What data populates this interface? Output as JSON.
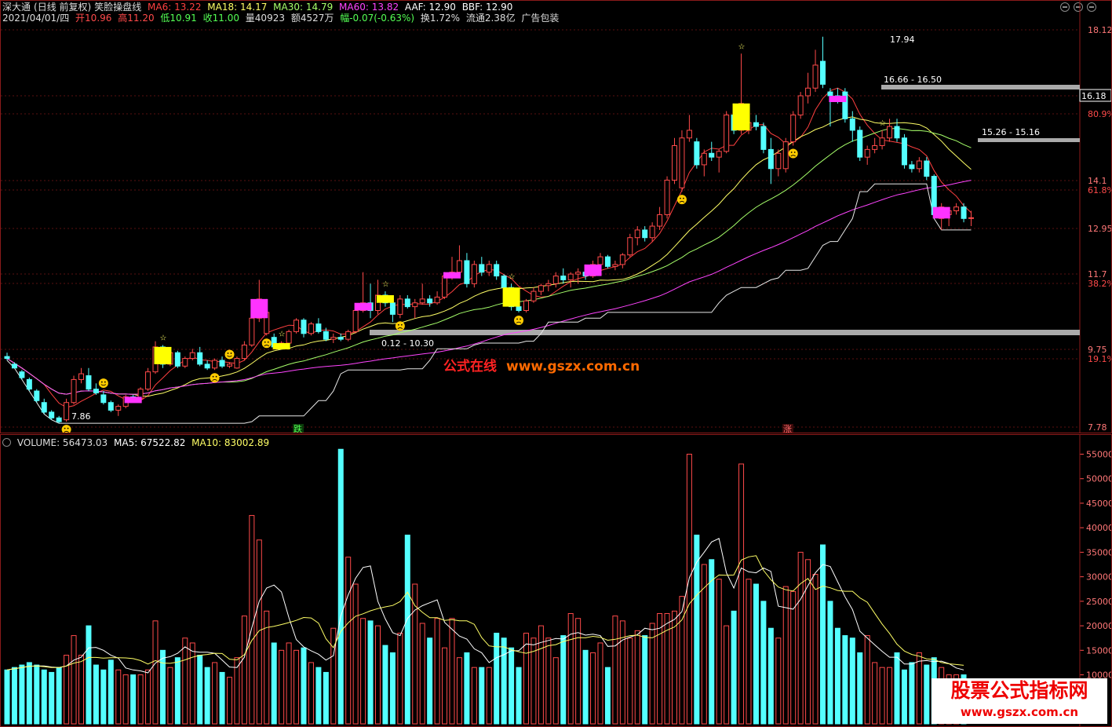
{
  "header1": {
    "security": "深大通",
    "mode": "(日线 前复权)",
    "indicator": "笑脸操盘线",
    "ma6": "MA6: 13.22",
    "ma18": "MA18: 14.17",
    "ma30": "MA30: 14.79",
    "ma60": "MA60: 13.82",
    "aaf": "AAF: 12.90",
    "bbf": "BBF: 12.90"
  },
  "header2": {
    "date": "2021/04/01/四",
    "open": "开10.96",
    "high": "高11.20",
    "low": "低10.91",
    "close": "收11.00",
    "volume": "量40923",
    "amount": "额4527万",
    "change": "幅-0.07(-0.63%)",
    "turnover": "换1.72%",
    "float": "流通2.38亿",
    "ads": "广告包装"
  },
  "price_axis": [
    "18.12",
    "16.18",
    "80.9%",
    "14.1",
    "61.8%",
    "12.95",
    "11.7",
    "38.2%",
    "9.75",
    "19.1%",
    "7.78"
  ],
  "price_tag": "16.18",
  "annotations": {
    "high_label": "17.94",
    "band1": "16.66 - 16.50",
    "band2": "15.26 - 15.16",
    "band3": "0.12 - 10.30",
    "low_label": "7.86",
    "fall_marker": "跌",
    "rise_marker": "涨"
  },
  "volume_header": {
    "volume": "VOLUME: 56473.03",
    "ma5": "MA5: 67522.82",
    "ma10": "MA10: 83002.89"
  },
  "volume_axis": [
    "55000",
    "50000",
    "45000",
    "40000",
    "35000",
    "30000",
    "25000",
    "20000",
    "15000",
    "10000"
  ],
  "watermarks": {
    "cn": "公式在线",
    "url": "www.gszx.com.cn",
    "brand": "股票公式指标网",
    "brand_url": "www.gszx.com.cn"
  },
  "colors": {
    "up": "#ff4a4a",
    "down": "#54ffff",
    "ma6": "#ff4040",
    "ma18": "#ffff66",
    "ma30": "#a6ff6a",
    "ma60": "#ff44ff",
    "band": "#aaaaaa"
  },
  "chart_data": {
    "type": "candlestick",
    "y_range": [
      7.78,
      18.12
    ],
    "candles": [
      {
        "o": 9.6,
        "h": 9.7,
        "l": 9.5,
        "c": 9.55
      },
      {
        "o": 9.4,
        "h": 9.45,
        "l": 9.3,
        "c": 9.3
      },
      {
        "o": 9.2,
        "h": 9.25,
        "l": 9.0,
        "c": 9.05
      },
      {
        "o": 9.0,
        "h": 9.05,
        "l": 8.7,
        "c": 8.75
      },
      {
        "o": 8.7,
        "h": 8.75,
        "l": 8.4,
        "c": 8.45
      },
      {
        "o": 8.4,
        "h": 8.5,
        "l": 8.1,
        "c": 8.15
      },
      {
        "o": 8.15,
        "h": 8.2,
        "l": 7.95,
        "c": 8.0
      },
      {
        "o": 8.0,
        "h": 8.05,
        "l": 7.86,
        "c": 7.9
      },
      {
        "o": 7.95,
        "h": 8.5,
        "l": 7.9,
        "c": 8.4
      },
      {
        "o": 8.4,
        "h": 9.1,
        "l": 8.35,
        "c": 9.0
      },
      {
        "o": 9.0,
        "h": 9.3,
        "l": 8.9,
        "c": 9.15
      },
      {
        "o": 9.1,
        "h": 9.3,
        "l": 8.7,
        "c": 8.75
      },
      {
        "o": 8.75,
        "h": 8.9,
        "l": 8.6,
        "c": 8.65
      },
      {
        "o": 8.6,
        "h": 8.7,
        "l": 8.35,
        "c": 8.4
      },
      {
        "o": 8.4,
        "h": 8.45,
        "l": 8.15,
        "c": 8.2
      },
      {
        "o": 8.2,
        "h": 8.35,
        "l": 8.05,
        "c": 8.3
      },
      {
        "o": 8.3,
        "h": 8.6,
        "l": 8.25,
        "c": 8.55
      },
      {
        "o": 8.55,
        "h": 8.6,
        "l": 8.45,
        "c": 8.5
      },
      {
        "o": 8.5,
        "h": 8.8,
        "l": 8.45,
        "c": 8.75
      },
      {
        "o": 8.75,
        "h": 9.3,
        "l": 8.7,
        "c": 9.2
      },
      {
        "o": 9.2,
        "h": 10.0,
        "l": 9.15,
        "c": 9.85
      },
      {
        "o": 9.85,
        "h": 9.9,
        "l": 9.3,
        "c": 9.4
      },
      {
        "o": 9.4,
        "h": 9.8,
        "l": 9.35,
        "c": 9.7
      },
      {
        "o": 9.7,
        "h": 9.75,
        "l": 9.3,
        "c": 9.35
      },
      {
        "o": 9.35,
        "h": 9.6,
        "l": 9.3,
        "c": 9.55
      },
      {
        "o": 9.55,
        "h": 9.8,
        "l": 9.5,
        "c": 9.7
      },
      {
        "o": 9.7,
        "h": 9.85,
        "l": 9.35,
        "c": 9.4
      },
      {
        "o": 9.4,
        "h": 9.5,
        "l": 9.25,
        "c": 9.3
      },
      {
        "o": 9.3,
        "h": 9.55,
        "l": 9.25,
        "c": 9.5
      },
      {
        "o": 9.5,
        "h": 9.6,
        "l": 9.3,
        "c": 9.35
      },
      {
        "o": 9.35,
        "h": 9.45,
        "l": 9.3,
        "c": 9.4
      },
      {
        "o": 9.3,
        "h": 9.6,
        "l": 9.28,
        "c": 9.55
      },
      {
        "o": 9.55,
        "h": 10.0,
        "l": 9.5,
        "c": 9.9
      },
      {
        "o": 9.9,
        "h": 10.8,
        "l": 9.85,
        "c": 10.6
      },
      {
        "o": 10.6,
        "h": 11.6,
        "l": 10.5,
        "c": 11.1
      },
      {
        "o": 10.2,
        "h": 11.1,
        "l": 10.15,
        "c": 10.75
      },
      {
        "o": 10.1,
        "h": 10.2,
        "l": 9.8,
        "c": 9.85
      },
      {
        "o": 9.85,
        "h": 10.0,
        "l": 9.8,
        "c": 9.95
      },
      {
        "o": 9.95,
        "h": 10.3,
        "l": 9.9,
        "c": 10.25
      },
      {
        "o": 10.25,
        "h": 10.6,
        "l": 10.2,
        "c": 10.55
      },
      {
        "o": 10.55,
        "h": 10.6,
        "l": 10.1,
        "c": 10.2
      },
      {
        "o": 10.2,
        "h": 10.5,
        "l": 10.15,
        "c": 10.45
      },
      {
        "o": 10.45,
        "h": 10.6,
        "l": 10.2,
        "c": 10.25
      },
      {
        "o": 10.25,
        "h": 10.35,
        "l": 10.0,
        "c": 10.05
      },
      {
        "o": 10.05,
        "h": 10.2,
        "l": 9.95,
        "c": 10.1
      },
      {
        "o": 10.1,
        "h": 10.2,
        "l": 10.0,
        "c": 10.05
      },
      {
        "o": 10.05,
        "h": 10.3,
        "l": 10.0,
        "c": 10.25
      },
      {
        "o": 10.25,
        "h": 10.9,
        "l": 10.2,
        "c": 10.8
      },
      {
        "o": 10.8,
        "h": 11.8,
        "l": 10.75,
        "c": 11.0
      },
      {
        "o": 11.0,
        "h": 11.5,
        "l": 10.6,
        "c": 10.8
      },
      {
        "o": 10.8,
        "h": 11.6,
        "l": 10.7,
        "c": 11.2
      },
      {
        "o": 11.2,
        "h": 11.3,
        "l": 10.9,
        "c": 11.0
      },
      {
        "o": 11.0,
        "h": 11.1,
        "l": 10.5,
        "c": 10.7
      },
      {
        "o": 10.7,
        "h": 11.2,
        "l": 10.6,
        "c": 11.1
      },
      {
        "o": 11.1,
        "h": 11.2,
        "l": 10.85,
        "c": 10.9
      },
      {
        "o": 10.9,
        "h": 11.1,
        "l": 10.6,
        "c": 11.0
      },
      {
        "o": 11.0,
        "h": 11.5,
        "l": 10.95,
        "c": 11.1
      },
      {
        "o": 11.1,
        "h": 11.2,
        "l": 10.9,
        "c": 11.0
      },
      {
        "o": 11.0,
        "h": 11.3,
        "l": 10.95,
        "c": 11.15
      },
      {
        "o": 11.15,
        "h": 11.8,
        "l": 11.1,
        "c": 11.7
      },
      {
        "o": 11.7,
        "h": 12.2,
        "l": 11.6,
        "c": 11.8
      },
      {
        "o": 11.8,
        "h": 12.5,
        "l": 11.7,
        "c": 12.1
      },
      {
        "o": 12.1,
        "h": 12.3,
        "l": 11.4,
        "c": 11.5
      },
      {
        "o": 11.5,
        "h": 12.1,
        "l": 11.4,
        "c": 12.0
      },
      {
        "o": 12.0,
        "h": 12.2,
        "l": 11.7,
        "c": 11.8
      },
      {
        "o": 11.8,
        "h": 12.1,
        "l": 11.7,
        "c": 12.0
      },
      {
        "o": 12.0,
        "h": 12.1,
        "l": 11.6,
        "c": 11.7
      },
      {
        "o": 11.7,
        "h": 11.75,
        "l": 11.35,
        "c": 11.4
      },
      {
        "o": 11.4,
        "h": 11.5,
        "l": 10.8,
        "c": 10.9
      },
      {
        "o": 10.9,
        "h": 11.0,
        "l": 10.75,
        "c": 10.8
      },
      {
        "o": 10.8,
        "h": 11.1,
        "l": 10.75,
        "c": 11.05
      },
      {
        "o": 11.05,
        "h": 11.4,
        "l": 11.0,
        "c": 11.3
      },
      {
        "o": 11.3,
        "h": 11.5,
        "l": 11.2,
        "c": 11.45
      },
      {
        "o": 11.45,
        "h": 11.6,
        "l": 11.3,
        "c": 11.5
      },
      {
        "o": 11.5,
        "h": 11.8,
        "l": 11.4,
        "c": 11.7
      },
      {
        "o": 11.7,
        "h": 11.9,
        "l": 11.5,
        "c": 11.6
      },
      {
        "o": 11.6,
        "h": 11.8,
        "l": 11.4,
        "c": 11.75
      },
      {
        "o": 11.75,
        "h": 11.9,
        "l": 11.5,
        "c": 11.8
      },
      {
        "o": 11.8,
        "h": 12.0,
        "l": 11.6,
        "c": 11.7
      },
      {
        "o": 11.7,
        "h": 12.1,
        "l": 11.65,
        "c": 12.0
      },
      {
        "o": 12.0,
        "h": 12.3,
        "l": 11.9,
        "c": 12.2
      },
      {
        "o": 12.2,
        "h": 12.25,
        "l": 11.9,
        "c": 11.95
      },
      {
        "o": 11.95,
        "h": 12.1,
        "l": 11.85,
        "c": 12.0
      },
      {
        "o": 12.0,
        "h": 12.3,
        "l": 11.9,
        "c": 12.25
      },
      {
        "o": 12.25,
        "h": 12.8,
        "l": 12.2,
        "c": 12.7
      },
      {
        "o": 12.7,
        "h": 13.0,
        "l": 12.5,
        "c": 12.9
      },
      {
        "o": 12.9,
        "h": 13.0,
        "l": 12.6,
        "c": 12.7
      },
      {
        "o": 12.7,
        "h": 13.1,
        "l": 12.6,
        "c": 13.0
      },
      {
        "o": 13.0,
        "h": 13.5,
        "l": 12.9,
        "c": 13.3
      },
      {
        "o": 13.3,
        "h": 14.3,
        "l": 13.2,
        "c": 14.2
      },
      {
        "o": 14.2,
        "h": 15.3,
        "l": 14.1,
        "c": 15.1
      },
      {
        "o": 14.0,
        "h": 15.5,
        "l": 13.9,
        "c": 15.3
      },
      {
        "o": 15.3,
        "h": 15.9,
        "l": 15.2,
        "c": 15.5
      },
      {
        "o": 15.2,
        "h": 15.3,
        "l": 14.5,
        "c": 14.6
      },
      {
        "o": 14.6,
        "h": 15.0,
        "l": 14.3,
        "c": 14.9
      },
      {
        "o": 14.9,
        "h": 15.2,
        "l": 14.7,
        "c": 14.8
      },
      {
        "o": 14.8,
        "h": 15.0,
        "l": 14.4,
        "c": 14.95
      },
      {
        "o": 14.95,
        "h": 16.0,
        "l": 14.9,
        "c": 15.9
      },
      {
        "o": 15.9,
        "h": 16.2,
        "l": 15.4,
        "c": 15.5
      },
      {
        "o": 15.5,
        "h": 17.5,
        "l": 15.4,
        "c": 16.2
      },
      {
        "o": 15.5,
        "h": 15.8,
        "l": 15.4,
        "c": 15.7
      },
      {
        "o": 15.7,
        "h": 15.9,
        "l": 15.5,
        "c": 15.6
      },
      {
        "o": 15.6,
        "h": 15.7,
        "l": 14.9,
        "c": 15.0
      },
      {
        "o": 15.0,
        "h": 15.3,
        "l": 14.1,
        "c": 14.5
      },
      {
        "o": 14.5,
        "h": 15.0,
        "l": 14.3,
        "c": 14.9
      },
      {
        "o": 14.5,
        "h": 15.3,
        "l": 14.4,
        "c": 15.2
      },
      {
        "o": 15.2,
        "h": 16.0,
        "l": 15.1,
        "c": 15.9
      },
      {
        "o": 15.9,
        "h": 16.5,
        "l": 15.8,
        "c": 16.4
      },
      {
        "o": 16.4,
        "h": 17.0,
        "l": 16.2,
        "c": 16.6
      },
      {
        "o": 16.6,
        "h": 17.6,
        "l": 16.5,
        "c": 17.2
      },
      {
        "o": 17.3,
        "h": 17.94,
        "l": 16.6,
        "c": 16.7
      },
      {
        "o": 16.5,
        "h": 16.6,
        "l": 15.6,
        "c": 16.4
      },
      {
        "o": 16.4,
        "h": 16.6,
        "l": 16.2,
        "c": 16.3
      },
      {
        "o": 16.5,
        "h": 16.6,
        "l": 15.7,
        "c": 15.8
      },
      {
        "o": 15.8,
        "h": 16.0,
        "l": 15.2,
        "c": 15.5
      },
      {
        "o": 15.5,
        "h": 15.6,
        "l": 14.7,
        "c": 14.8
      },
      {
        "o": 14.8,
        "h": 15.1,
        "l": 14.6,
        "c": 15.0
      },
      {
        "o": 15.0,
        "h": 15.3,
        "l": 14.9,
        "c": 15.1
      },
      {
        "o": 15.1,
        "h": 15.5,
        "l": 15.0,
        "c": 15.3
      },
      {
        "o": 15.3,
        "h": 15.8,
        "l": 15.2,
        "c": 15.6
      },
      {
        "o": 15.6,
        "h": 15.8,
        "l": 15.2,
        "c": 15.3
      },
      {
        "o": 15.3,
        "h": 15.4,
        "l": 14.5,
        "c": 14.6
      },
      {
        "o": 14.6,
        "h": 14.7,
        "l": 14.4,
        "c": 14.5
      },
      {
        "o": 14.5,
        "h": 14.8,
        "l": 14.4,
        "c": 14.7
      },
      {
        "o": 14.7,
        "h": 14.8,
        "l": 14.2,
        "c": 14.3
      },
      {
        "o": 14.3,
        "h": 14.35,
        "l": 13.2,
        "c": 13.3
      },
      {
        "o": 13.2,
        "h": 13.6,
        "l": 12.9,
        "c": 13.5
      },
      {
        "o": 13.3,
        "h": 13.5,
        "l": 13.0,
        "c": 13.4
      },
      {
        "o": 13.4,
        "h": 13.6,
        "l": 13.3,
        "c": 13.5
      },
      {
        "o": 13.5,
        "h": 13.6,
        "l": 13.1,
        "c": 13.2
      },
      {
        "o": 13.2,
        "h": 13.4,
        "l": 13.0,
        "c": 13.22
      }
    ],
    "volume_y_range": [
      0,
      57000
    ],
    "volumes": [
      11000,
      11500,
      12000,
      12500,
      12000,
      11000,
      10500,
      11500,
      14000,
      18000,
      14000,
      20000,
      12000,
      11000,
      13000,
      11000,
      10000,
      10000,
      10000,
      11000,
      21000,
      15000,
      11500,
      13500,
      17500,
      16500,
      14000,
      11500,
      12500,
      10500,
      9500,
      13500,
      22000,
      42500,
      37500,
      23000,
      16500,
      15000,
      16500,
      15000,
      15500,
      12500,
      11500,
      10500,
      19500,
      56000,
      34000,
      28500,
      21500,
      21000,
      20000,
      16000,
      14500,
      18500,
      38500,
      28500,
      20500,
      17500,
      21500,
      15500,
      21500,
      13500,
      14500,
      11500,
      11500,
      11500,
      18500,
      17500,
      15500,
      11500,
      18500,
      17500,
      20000,
      17500,
      13500,
      18000,
      22500,
      21500,
      15000,
      14500,
      16500,
      11500,
      22000,
      21000,
      17500,
      19000,
      18000,
      20500,
      22500,
      22500,
      23000,
      26000,
      55000,
      38500,
      32500,
      33500,
      29500,
      20000,
      23000,
      53000,
      29500,
      28500,
      25000,
      19500,
      17500,
      28000,
      27000,
      35000,
      33500,
      30500,
      36500,
      25000,
      19500,
      18000,
      17500,
      14500,
      18000,
      12500,
      11500,
      11500,
      14500,
      11000,
      12500,
      14500,
      12000,
      13500,
      11500,
      10000,
      10000,
      10000
    ]
  }
}
